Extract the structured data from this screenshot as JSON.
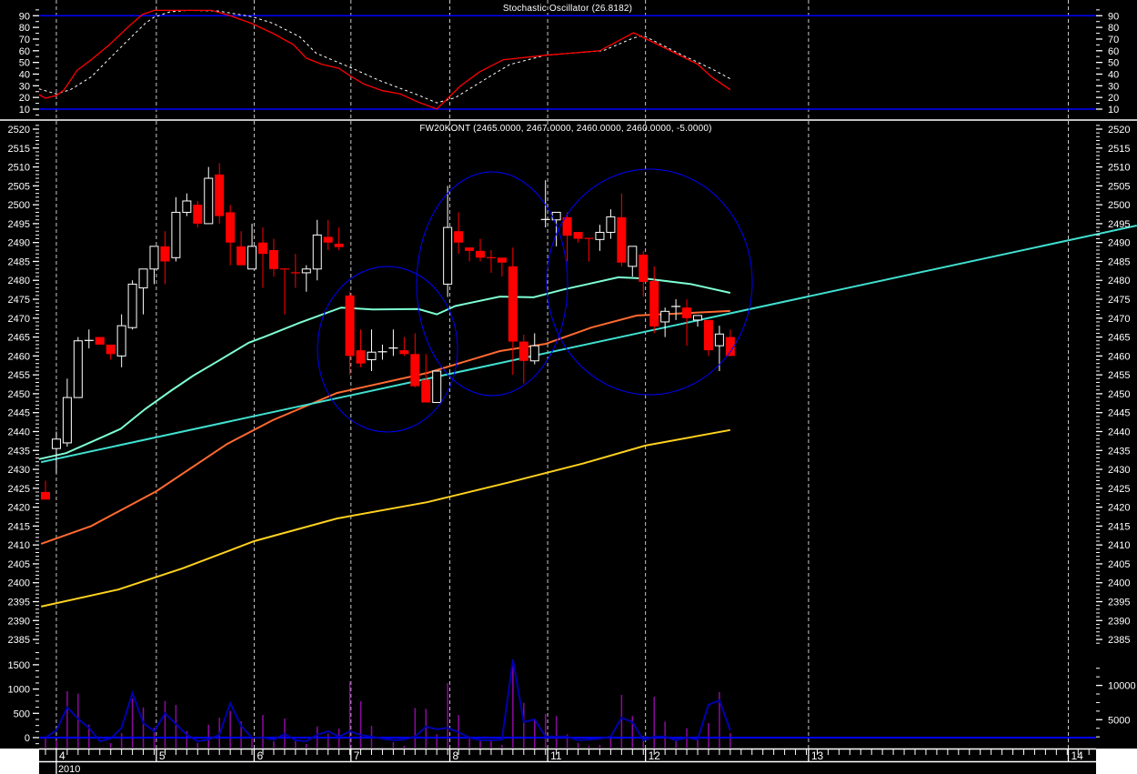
{
  "chart_data": {
    "type": "candlestick",
    "title": "FW20KONT (2465.0000, 2467.0000, 2460.0000, 2460.0000, -5.0000)",
    "stochastic_title": "Stochastic Oscillator (26.8182)",
    "colors": {
      "up": "#ffffff",
      "down": "#ff0000",
      "ma1": "#7fffd4",
      "ma2": "#ff6a30",
      "ma3": "#ffd21e",
      "trendline": "#40e0d0",
      "stoch_k": "#ff0000",
      "stoch_d": "#ffffff",
      "volume_bars": "#8b0a9e",
      "volume_line": "#0000b0",
      "level_lines": "#0000ff",
      "circles": "#0000ff",
      "grid": "#c8c8c8"
    },
    "price_axis": {
      "ylim": [
        2385,
        2520
      ],
      "ticks": [
        2385,
        2390,
        2395,
        2400,
        2405,
        2410,
        2415,
        2420,
        2425,
        2430,
        2435,
        2440,
        2445,
        2450,
        2455,
        2460,
        2465,
        2470,
        2475,
        2480,
        2485,
        2490,
        2495,
        2500,
        2505,
        2510,
        2515,
        2520
      ]
    },
    "stoch_axis": {
      "ylim": [
        10,
        90
      ],
      "ticks": [
        10,
        20,
        30,
        40,
        50,
        60,
        70,
        80,
        90
      ],
      "levels": [
        10,
        90
      ]
    },
    "volume_left_axis": {
      "ticks": [
        0,
        500,
        1000,
        1500
      ]
    },
    "volume_right_axis": {
      "ticks": [
        5000,
        10000
      ]
    },
    "x_axis": {
      "year_label": "2010",
      "date_labels": [
        {
          "label": "4",
          "index": 1
        },
        {
          "label": "5",
          "index": 10.2
        },
        {
          "label": "6",
          "index": 19.2
        },
        {
          "label": "7",
          "index": 28.1
        },
        {
          "label": "8",
          "index": 37.2
        },
        {
          "label": "11",
          "index": 46.2
        },
        {
          "label": "12",
          "index": 55.2
        },
        {
          "label": "13",
          "index": 70.2
        },
        {
          "label": "14",
          "index": 94.1
        }
      ]
    },
    "ohlc": [
      [
        2424,
        2427,
        2422,
        2422
      ],
      [
        2435.5,
        2440,
        2429,
        2438
      ],
      [
        2437,
        2454,
        2436,
        2449
      ],
      [
        2449,
        2465,
        2449,
        2464
      ],
      [
        2464,
        2467,
        2462,
        2464.1
      ],
      [
        2465,
        2465,
        2463,
        2463
      ],
      [
        2463,
        2463,
        2459,
        2460.5
      ],
      [
        2460,
        2471,
        2457,
        2468
      ],
      [
        2467.5,
        2480,
        2467,
        2479
      ],
      [
        2478,
        2483,
        2471,
        2483
      ],
      [
        2483,
        2489,
        2479,
        2489
      ],
      [
        2489,
        2493,
        2479,
        2485
      ],
      [
        2486,
        2502,
        2485,
        2498
      ],
      [
        2498,
        2503,
        2497,
        2501
      ],
      [
        2500,
        2501,
        2494,
        2495
      ],
      [
        2495,
        2510,
        2495,
        2507
      ],
      [
        2508,
        2511,
        2495,
        2497
      ],
      [
        2498,
        2500,
        2484,
        2490
      ],
      [
        2489,
        2493,
        2484,
        2484
      ],
      [
        2483,
        2495,
        2483,
        2489
      ],
      [
        2490,
        2494,
        2478,
        2487
      ],
      [
        2488,
        2491,
        2481,
        2483
      ],
      [
        2483,
        2483,
        2471,
        2482.9
      ],
      [
        2482,
        2487,
        2478,
        2481.9
      ],
      [
        2482,
        2484,
        2477,
        2483
      ],
      [
        2483,
        2496,
        2480,
        2492
      ],
      [
        2491.5,
        2496,
        2488,
        2490
      ],
      [
        2489.7,
        2494,
        2488,
        2488.8
      ],
      [
        2476,
        2477,
        2455,
        2460
      ],
      [
        2461.5,
        2467,
        2457,
        2458
      ],
      [
        2459,
        2467,
        2456,
        2461
      ],
      [
        2461,
        2463,
        2459,
        2461.1
      ],
      [
        2462,
        2467,
        2460,
        2462.1
      ],
      [
        2461.5,
        2465,
        2460,
        2460.5
      ],
      [
        2460.5,
        2466,
        2451.7,
        2452
      ],
      [
        2453.7,
        2460.5,
        2447.7,
        2447.7
      ],
      [
        2447.7,
        2456,
        2447.7,
        2456
      ],
      [
        2479,
        2505,
        2475.6,
        2494
      ],
      [
        2493,
        2498,
        2487,
        2490
      ],
      [
        2488.7,
        2488.7,
        2485,
        2487.8
      ],
      [
        2487.8,
        2491,
        2485,
        2486
      ],
      [
        2486,
        2488,
        2482,
        2485.9
      ],
      [
        2486,
        2486,
        2481,
        2484.7
      ],
      [
        2483.7,
        2488.7,
        2455,
        2463.8
      ],
      [
        2463.8,
        2465.6,
        2452.7,
        2458.7
      ],
      [
        2458.7,
        2466,
        2457.8,
        2462.7
      ],
      [
        2496,
        2506.5,
        2494,
        2496.1
      ],
      [
        2496,
        2498,
        2489,
        2498
      ],
      [
        2496.7,
        2498,
        2485,
        2491.8
      ],
      [
        2492.8,
        2492.8,
        2490,
        2491
      ],
      [
        2491.1,
        2491.1,
        2485,
        2491
      ],
      [
        2490.8,
        2494.7,
        2487.8,
        2492.7
      ],
      [
        2492.7,
        2498.8,
        2491,
        2496.8
      ],
      [
        2496.7,
        2503,
        2483.7,
        2484.7
      ],
      [
        2483.7,
        2489,
        2481,
        2489
      ],
      [
        2486.8,
        2487.8,
        2475.7,
        2479.6
      ],
      [
        2479.8,
        2483.7,
        2466,
        2467.8
      ],
      [
        2469,
        2472.8,
        2465,
        2471.8
      ],
      [
        2473,
        2475,
        2469.5,
        2473.1
      ],
      [
        2472.8,
        2475,
        2462.7,
        2470
      ],
      [
        2469.5,
        2470.7,
        2467.8,
        2470.7
      ],
      [
        2469.5,
        2469.5,
        2460,
        2461.5
      ],
      [
        2462.7,
        2468,
        2456,
        2465.8
      ],
      [
        2465,
        2467,
        2460,
        2460
      ]
    ],
    "moving_averages": [
      {
        "name": "ma1",
        "points": [
          [
            -0.6,
            2432.7
          ],
          [
            1.9,
            2434.3
          ],
          [
            4.8,
            2438
          ],
          [
            6.9,
            2440.7
          ],
          [
            9.2,
            2446
          ],
          [
            11.5,
            2450.7
          ],
          [
            13.6,
            2454.8
          ],
          [
            15.9,
            2458.7
          ],
          [
            18.7,
            2463.5
          ],
          [
            20.1,
            2465
          ],
          [
            23.4,
            2468.8
          ],
          [
            27.2,
            2472.8
          ],
          [
            30.1,
            2472.3
          ],
          [
            34.3,
            2472.4
          ],
          [
            36,
            2471
          ],
          [
            37.7,
            2473.2
          ],
          [
            41.8,
            2475.7
          ],
          [
            44.9,
            2475.5
          ],
          [
            47.7,
            2477.6
          ],
          [
            52.7,
            2480.8
          ],
          [
            55.2,
            2480.5
          ],
          [
            59.4,
            2479
          ],
          [
            63,
            2476.7
          ]
        ]
      },
      {
        "name": "ma2",
        "points": [
          [
            -0.4,
            2410.3
          ],
          [
            4.2,
            2415
          ],
          [
            10.2,
            2424.2
          ],
          [
            16.7,
            2436.7
          ],
          [
            20.9,
            2443
          ],
          [
            26.8,
            2450.2
          ],
          [
            35.1,
            2455.5
          ],
          [
            41.8,
            2461.3
          ],
          [
            46,
            2463.2
          ],
          [
            50.2,
            2467.5
          ],
          [
            54.4,
            2470.7
          ],
          [
            63,
            2471.9
          ]
        ]
      },
      {
        "name": "ma3",
        "points": [
          [
            -0.4,
            2393.7
          ],
          [
            6.7,
            2398.2
          ],
          [
            12.6,
            2403.8
          ],
          [
            19.2,
            2411
          ],
          [
            26.8,
            2417
          ],
          [
            35.1,
            2421.3
          ],
          [
            42.7,
            2426.6
          ],
          [
            49.4,
            2431.5
          ],
          [
            55.2,
            2436.3
          ],
          [
            63,
            2440.4
          ]
        ]
      }
    ],
    "trendline": [
      [
        -0.4,
        2431.9
      ],
      [
        100.4,
        2494.5
      ]
    ],
    "stochastic": {
      "k": [
        [
          -0.6,
          22.5
        ],
        [
          0,
          19.4
        ],
        [
          1,
          21.7
        ],
        [
          1.7,
          26.4
        ],
        [
          2.9,
          43.2
        ],
        [
          4.2,
          52.3
        ],
        [
          5.9,
          65.3
        ],
        [
          7.5,
          79.5
        ],
        [
          8.9,
          91
        ],
        [
          10,
          94.6
        ],
        [
          15.3,
          94.6
        ],
        [
          17,
          90
        ],
        [
          19,
          83.3
        ],
        [
          20.9,
          75
        ],
        [
          22.8,
          65.3
        ],
        [
          24,
          53.7
        ],
        [
          25.4,
          48.5
        ],
        [
          27,
          45
        ],
        [
          27.9,
          39.3
        ],
        [
          29.3,
          31.5
        ],
        [
          31,
          25.8
        ],
        [
          32.6,
          23.2
        ],
        [
          34.3,
          16
        ],
        [
          36,
          10.2
        ],
        [
          38.2,
          30
        ],
        [
          39.9,
          41.7
        ],
        [
          42.1,
          52.3
        ],
        [
          46,
          56.2
        ],
        [
          51,
          60
        ],
        [
          54.1,
          75.4
        ],
        [
          57.2,
          61.4
        ],
        [
          60,
          48.5
        ],
        [
          61.3,
          37.5
        ],
        [
          63,
          26.6
        ]
      ],
      "d": [
        [
          -0.6,
          27.4
        ],
        [
          1,
          23
        ],
        [
          2.3,
          26.7
        ],
        [
          4.2,
          37.6
        ],
        [
          6.9,
          62.7
        ],
        [
          9.2,
          83.6
        ],
        [
          10,
          88.8
        ],
        [
          11.5,
          93.4
        ],
        [
          13.1,
          94.6
        ],
        [
          15.9,
          94
        ],
        [
          19,
          89.2
        ],
        [
          20.9,
          83.6
        ],
        [
          23.4,
          71.9
        ],
        [
          24.9,
          57.9
        ],
        [
          27.9,
          46.3
        ],
        [
          30.7,
          34.6
        ],
        [
          34.3,
          22
        ],
        [
          36,
          15.4
        ],
        [
          37.7,
          19.8
        ],
        [
          40.4,
          35.3
        ],
        [
          42.7,
          48.2
        ],
        [
          46,
          56.2
        ],
        [
          51.3,
          60
        ],
        [
          54.1,
          71
        ],
        [
          55,
          73
        ],
        [
          58.6,
          56.2
        ],
        [
          61.3,
          44.5
        ],
        [
          63,
          36
        ]
      ]
    },
    "volume": [
      2387,
      2000,
      9150,
      8790,
      4280,
      970,
      1590,
      3050,
      8090,
      6800,
      3850,
      7730,
      7160,
      3320,
      1620,
      4280,
      5300,
      6270,
      4770,
      2520,
      5700,
      1860,
      5170,
      1860,
      1460,
      4020,
      2960,
      3710,
      10570,
      7690,
      4110,
      970,
      1720,
      1190,
      6720,
      6590,
      2880,
      10340,
      5700,
      2290,
      1860,
      1860,
      1330,
      13790,
      7470,
      5170,
      5830,
      5530,
      2880,
      1630,
      1190,
      1330,
      2520,
      8620,
      5530,
      2650,
      8350,
      4730,
      1860,
      3750,
      2290,
      4510,
      9020,
      3050
    ],
    "volume_line": [
      0,
      150,
      620,
      390,
      200,
      -75,
      -20,
      200,
      920,
      300,
      130,
      500,
      280,
      60,
      -75,
      -40,
      60,
      710,
      240,
      0,
      0,
      -40,
      75,
      -55,
      -75,
      60,
      130,
      20,
      130,
      56,
      20,
      -20,
      -55,
      -40,
      20,
      225,
      170,
      200,
      110,
      0,
      -55,
      -55,
      -40,
      1610,
      320,
      375,
      20,
      20,
      20,
      -55,
      -40,
      -20,
      20,
      410,
      320,
      -55,
      20,
      20,
      -55,
      0,
      -40,
      675,
      770,
      150
    ]
  }
}
